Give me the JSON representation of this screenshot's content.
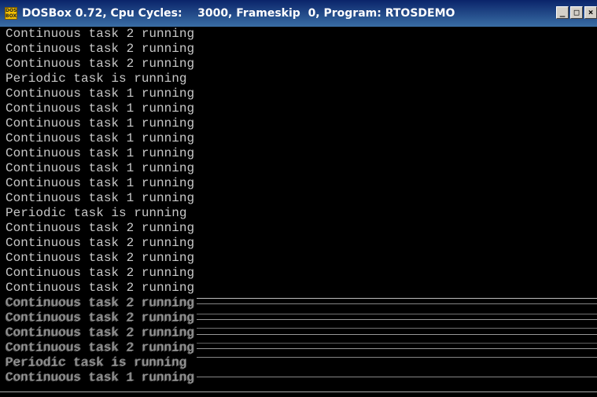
{
  "window": {
    "title": "DOSBox 0.72, Cpu Cycles:    3000, Frameskip  0, Program: RTOSDEMO",
    "icon": "dosbox-icon",
    "icon_text": "DOS BOX",
    "controls": {
      "minimize": "_",
      "maximize": "□",
      "close": "×"
    }
  },
  "console": {
    "lines": [
      "Continuous task 2 running",
      "Continuous task 2 running",
      "Continuous task 2 running",
      "Periodic task is running",
      "Continuous task 1 running",
      "Continuous task 1 running",
      "Continuous task 1 running",
      "Continuous task 1 running",
      "Continuous task 1 running",
      "Continuous task 1 running",
      "Continuous task 1 running",
      "Continuous task 1 running",
      "Periodic task is running",
      "Continuous task 2 running",
      "Continuous task 2 running",
      "Continuous task 2 running",
      "Continuous task 2 running",
      "Continuous task 2 running",
      "Continuous task 2 running",
      "Continuous task 2 running",
      "Continuous task 2 running",
      "Continuous task 2 running",
      "Periodic task is running",
      "Continuous task 1 running"
    ]
  }
}
